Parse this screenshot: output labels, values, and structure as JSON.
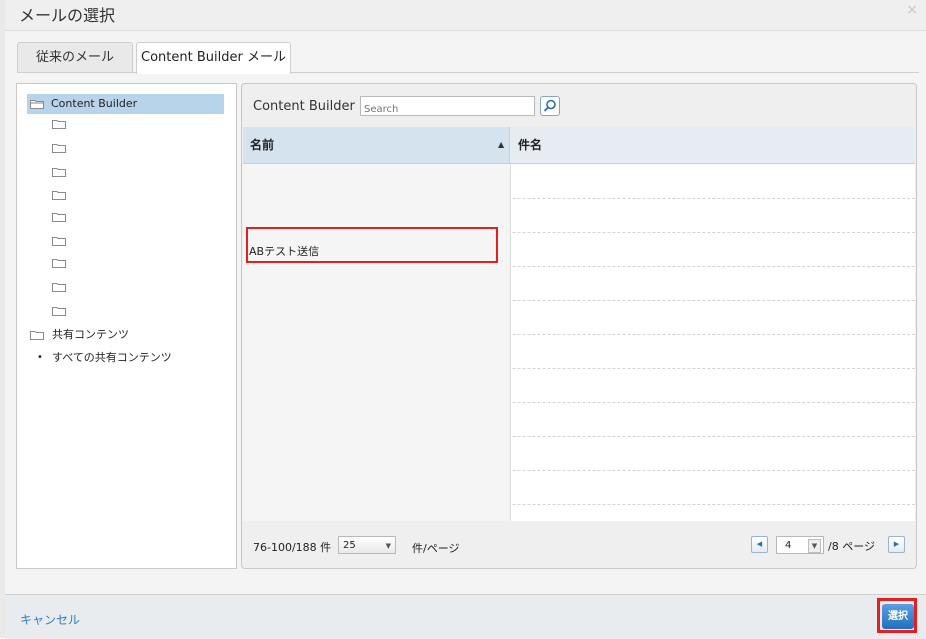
{
  "dialog": {
    "title": "メールの選択",
    "close_glyph": "×"
  },
  "tabs": [
    {
      "label": "従来のメール",
      "active": false
    },
    {
      "label": "Content Builder メール",
      "active": true
    }
  ],
  "tree": {
    "root_label": "Content Builder",
    "unnamed_folder_count": 9,
    "shared_label": "共有コンテンツ",
    "shared_child_label": "すべての共有コンテンツ",
    "bullet": "•"
  },
  "list": {
    "toolbar_title": "Content Builder",
    "search_placeholder": "Search",
    "columns": {
      "name": "名前",
      "subject": "件名"
    },
    "sort_indicator": "▲",
    "rows": [
      {
        "name": ""
      },
      {
        "name": ""
      },
      {
        "name": "ABテスト送信",
        "highlighted": true
      },
      {
        "name": ""
      },
      {
        "name": ""
      },
      {
        "name": ""
      },
      {
        "name": ""
      },
      {
        "name": ""
      },
      {
        "name": ""
      },
      {
        "name": ""
      },
      {
        "name": ""
      }
    ]
  },
  "pager": {
    "range_text": "76-100/188 件",
    "per_page_value": "25",
    "per_page_label": "件/ページ",
    "prev_glyph": "◀",
    "current_page": "4",
    "total_pages_text": "/8 ページ",
    "next_glyph": "▶",
    "caret_glyph": "▼"
  },
  "footer": {
    "cancel_label": "キャンセル",
    "select_label": "選択"
  },
  "colors": {
    "highlight_border": "#e51f1f",
    "selection_bg": "#b8d4ea",
    "primary_button": "#2a78c8",
    "link": "#2f7fc1"
  }
}
